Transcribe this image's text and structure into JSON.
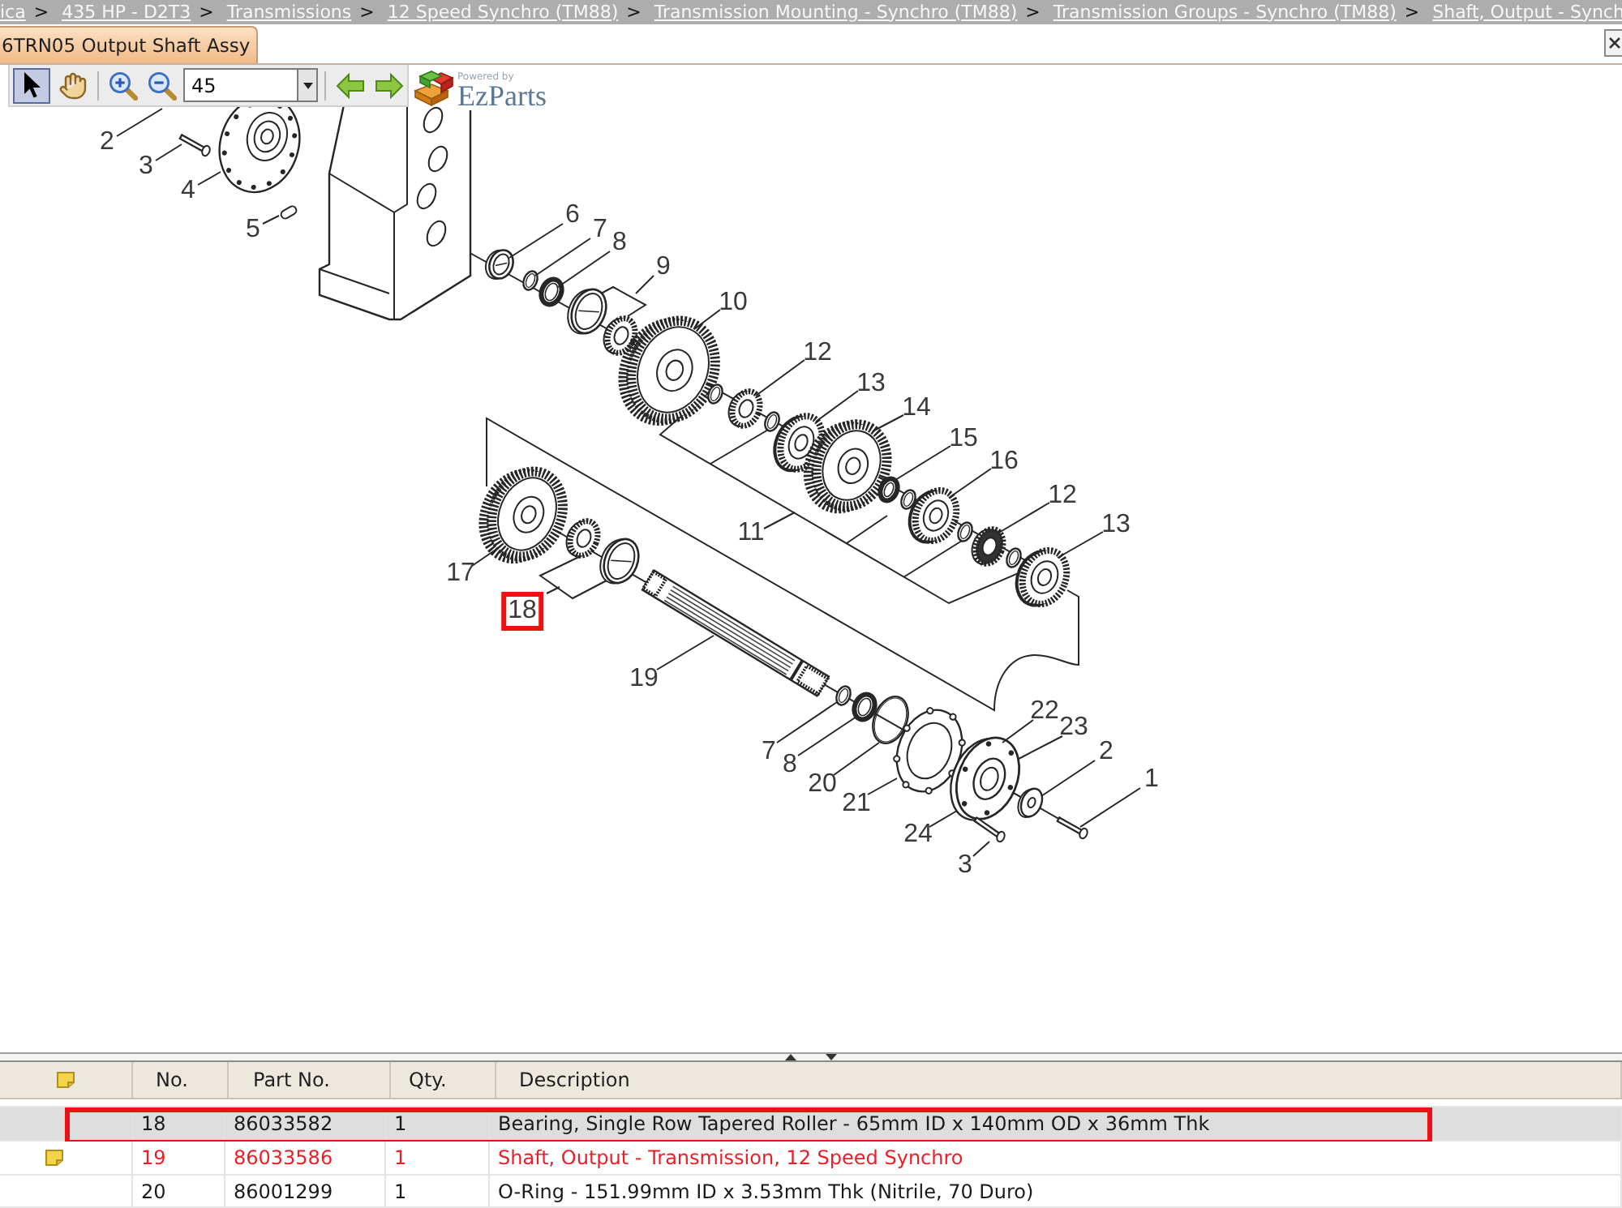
{
  "breadcrumb": [
    {
      "label": "ica",
      "separator": ">"
    },
    {
      "label": "435 HP - D2T3",
      "separator": ">"
    },
    {
      "label": "Transmissions",
      "separator": ">"
    },
    {
      "label": "12 Speed Synchro (TM88)",
      "separator": ">"
    },
    {
      "label": "Transmission Mounting - Synchro (TM88)",
      "separator": ">"
    },
    {
      "label": "Transmission Groups - Synchro (TM88)",
      "separator": ">"
    },
    {
      "label": "Shaft, Output - Synch"
    }
  ],
  "tabs": [
    {
      "label": "6TRN05 Output Shaft Assy",
      "selected": true
    }
  ],
  "toolbar": {
    "tools": [
      {
        "kind": "pointer",
        "selected": true
      },
      {
        "kind": "pan",
        "selected": false
      }
    ],
    "zoom": {
      "value": "45"
    }
  },
  "logo": {
    "tagline": "Powered by",
    "name": "EzParts"
  },
  "diagram": {
    "callouts": [
      {
        "label": "2",
        "selected": false
      },
      {
        "label": "3",
        "selected": false
      },
      {
        "label": "4",
        "selected": false
      },
      {
        "label": "5",
        "selected": false
      },
      {
        "label": "6",
        "selected": false
      },
      {
        "label": "7",
        "selected": false
      },
      {
        "label": "8",
        "selected": false
      },
      {
        "label": "9",
        "selected": false
      },
      {
        "label": "10",
        "selected": false
      },
      {
        "label": "12",
        "selected": false
      },
      {
        "label": "13",
        "selected": false
      },
      {
        "label": "14",
        "selected": false
      },
      {
        "label": "15",
        "selected": false
      },
      {
        "label": "16",
        "selected": false
      },
      {
        "label": "12",
        "selected": false
      },
      {
        "label": "13",
        "selected": false
      },
      {
        "label": "11",
        "selected": false
      },
      {
        "label": "17",
        "selected": false
      },
      {
        "label": "18",
        "selected": true
      },
      {
        "label": "19",
        "selected": false
      },
      {
        "label": "7",
        "selected": false
      },
      {
        "label": "8",
        "selected": false
      },
      {
        "label": "20",
        "selected": false
      },
      {
        "label": "21",
        "selected": false
      },
      {
        "label": "22",
        "selected": false
      },
      {
        "label": "23",
        "selected": false
      },
      {
        "label": "2",
        "selected": false
      },
      {
        "label": "1",
        "selected": false
      },
      {
        "label": "24",
        "selected": false
      },
      {
        "label": "3",
        "selected": false
      }
    ]
  },
  "parts_table": {
    "columns": [
      "No.",
      "Part No.",
      "Qty.",
      "Description"
    ],
    "rows": [
      {
        "no": "18",
        "part_no": "86033582",
        "qty": "1",
        "description": "Bearing, Single Row Tapered Roller - 65mm ID x 140mm OD x 36mm Thk",
        "selected": true,
        "has_note": false
      },
      {
        "no": "19",
        "part_no": "86033586",
        "qty": "1",
        "description": "Shaft, Output - Transmission, 12 Speed Synchro",
        "selected": false,
        "has_note": true
      },
      {
        "no": "20",
        "part_no": "86001299",
        "qty": "1",
        "description": "O-Ring - 151.99mm ID x 3.53mm Thk (Nitrile, 70 Duro)",
        "selected": false,
        "has_note": false
      }
    ]
  }
}
